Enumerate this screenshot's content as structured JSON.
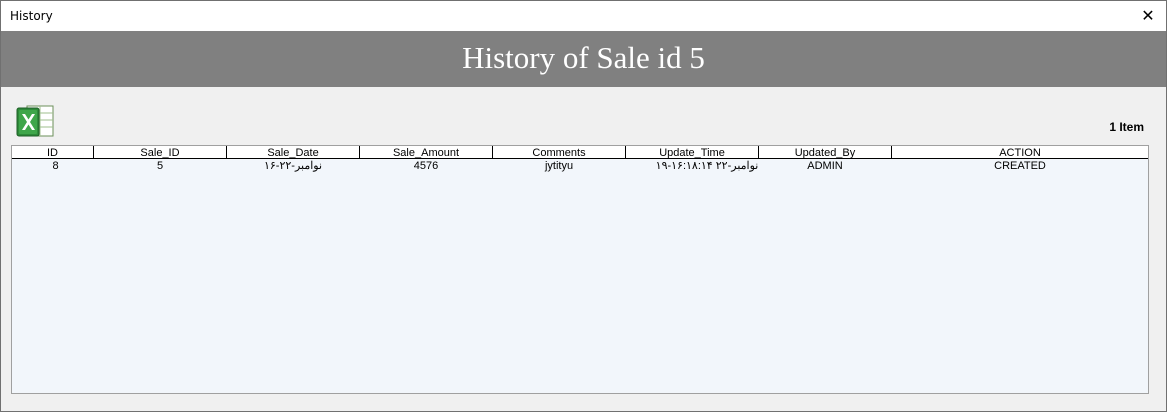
{
  "window": {
    "title": "History",
    "close_glyph": "✕"
  },
  "banner": {
    "title": "History of Sale id 5",
    "background": "#808080"
  },
  "toolbar": {
    "export_icon": "excel-icon",
    "item_count": "1 Item"
  },
  "table": {
    "columns": [
      "ID",
      "Sale_ID",
      "Sale_Date",
      "Sale_Amount",
      "Comments",
      "Update_Time",
      "Updated_By",
      "ACTION"
    ],
    "rows": [
      [
        "8",
        "5",
        "۱۶-نوامبر-۲۲",
        "4576",
        "jytityu",
        "۱۹-نوامبر-۲۲ ۱۶:۱۸:۱۴",
        "ADMIN",
        "CREATED"
      ]
    ]
  }
}
